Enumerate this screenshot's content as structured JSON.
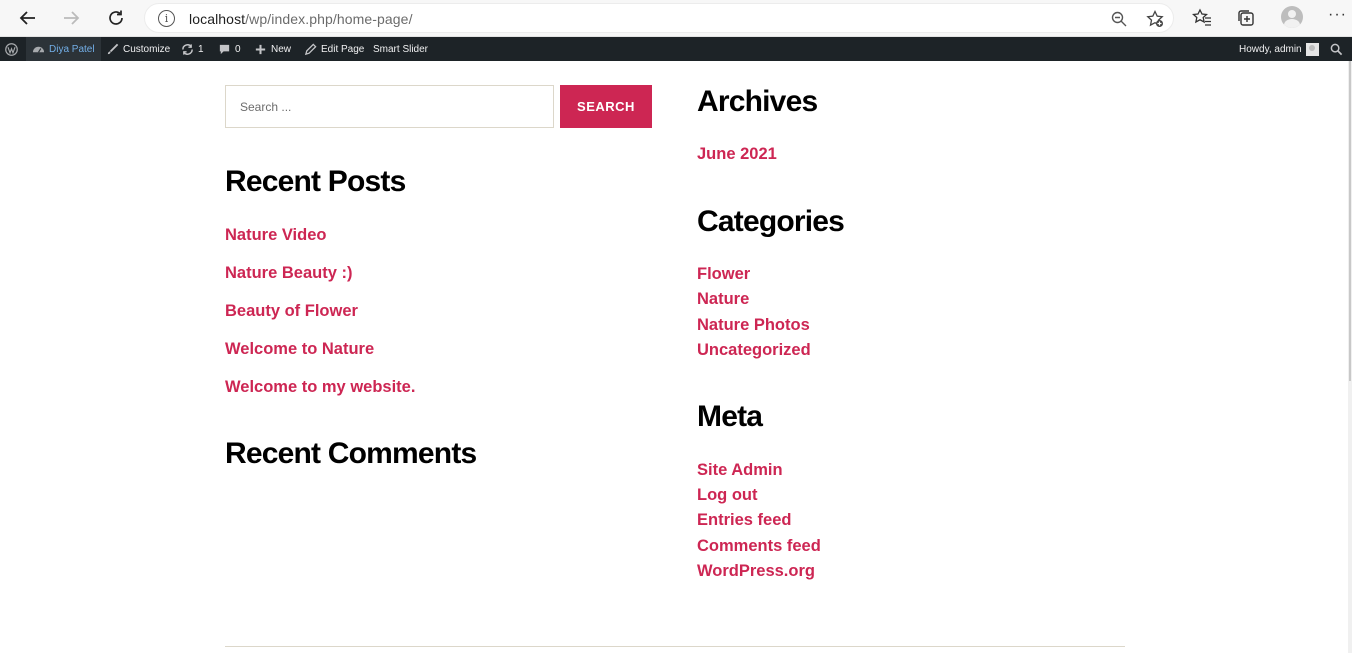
{
  "browser": {
    "url_host": "localhost",
    "url_path": "/wp/index.php/home-page/"
  },
  "adminbar": {
    "site_name": "Diya Patel",
    "customize": "Customize",
    "updates_count": "1",
    "comments_count": "0",
    "new": "New",
    "edit_page": "Edit Page",
    "smart_slider": "Smart Slider",
    "howdy": "Howdy, admin"
  },
  "search": {
    "placeholder": "Search ...",
    "button_label": "SEARCH"
  },
  "recent_posts": {
    "title": "Recent Posts",
    "items": [
      "Nature Video",
      "Nature Beauty :)",
      "Beauty of Flower",
      "Welcome to Nature",
      "Welcome to my website."
    ]
  },
  "recent_comments": {
    "title": "Recent Comments"
  },
  "archives": {
    "title": "Archives",
    "items": [
      "June 2021"
    ]
  },
  "categories": {
    "title": "Categories",
    "items": [
      "Flower",
      "Nature",
      "Nature Photos",
      "Uncategorized"
    ]
  },
  "meta": {
    "title": "Meta",
    "items": [
      "Site Admin",
      "Log out",
      "Entries feed",
      "Comments feed",
      "WordPress.org"
    ]
  },
  "colors": {
    "accent": "#cd2653",
    "adminbar_bg": "#1d2327"
  }
}
